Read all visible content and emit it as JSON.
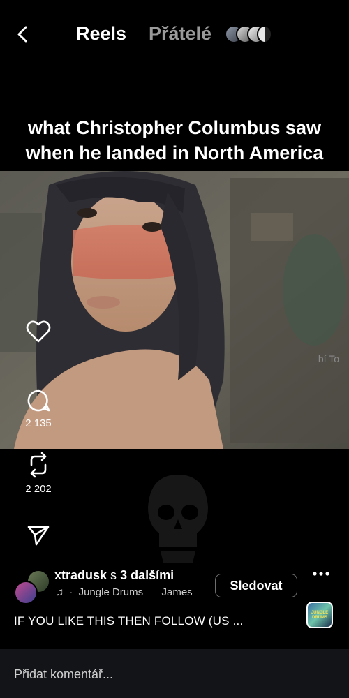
{
  "header": {
    "tab_reels": "Reels",
    "tab_friends": "Přátelé"
  },
  "reel": {
    "caption_title_line1": "what Christopher Columbus saw",
    "caption_title_line2": "when he landed in North America"
  },
  "actions": {
    "like_label": "bí   To",
    "comments_count": "2 135",
    "reposts_count": "2 202"
  },
  "author": {
    "username": "xtradusk",
    "coauthors_prefix": " s ",
    "coauthors": "3 dalšími",
    "follow_label": "Sledovat"
  },
  "music": {
    "song": "Jungle Drums",
    "artist": "James"
  },
  "audio_thumb": {
    "label": "JUNGLE DRUMS"
  },
  "description": "IF YOU LIKE THIS THEN FOLLOW (US ...",
  "comment": {
    "placeholder": "Přidat komentář..."
  },
  "colors": {
    "background": "#000000",
    "muted_tab": "#9a9a9a",
    "comment_bar": "#131417"
  }
}
